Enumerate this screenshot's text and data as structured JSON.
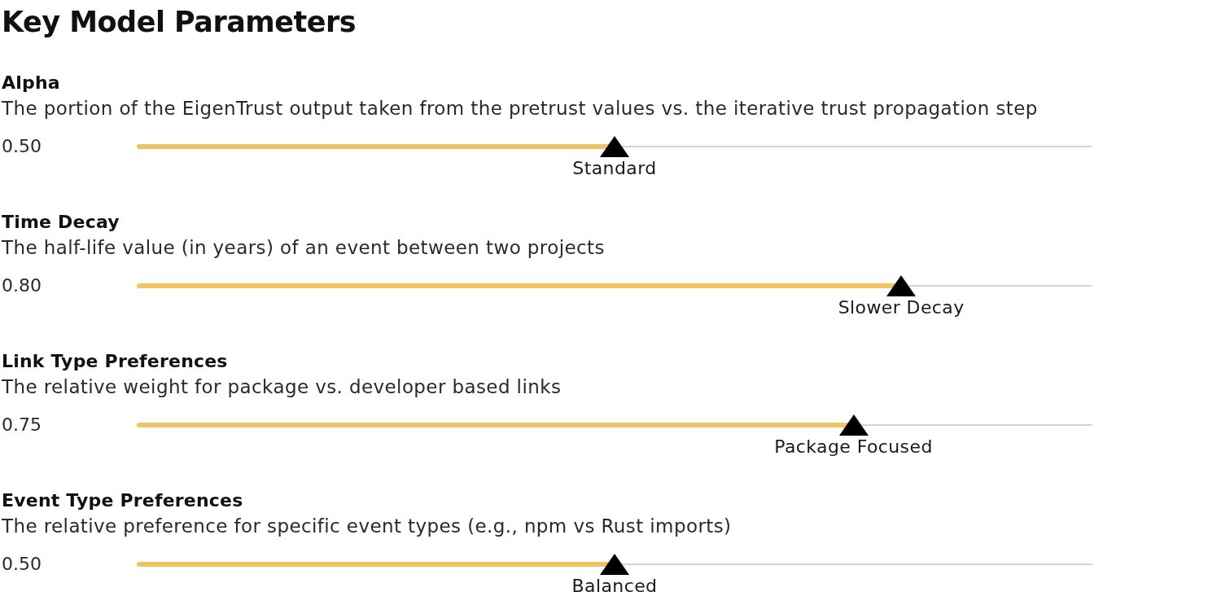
{
  "title": "Key Model Parameters",
  "parameters": [
    {
      "name": "Alpha",
      "description": "The portion of the EigenTrust output taken from the pretrust values vs. the iterative trust propagation step",
      "value": "0.50",
      "level": 0.5,
      "setting": "Standard"
    },
    {
      "name": "Time Decay",
      "description": "The half-life value (in years) of an event between two projects",
      "value": "0.80",
      "level": 0.8,
      "setting": "Slower Decay"
    },
    {
      "name": "Link Type Preferences",
      "description": "The relative weight for package vs. developer based links",
      "value": "0.75",
      "level": 0.75,
      "setting": "Package Focused"
    },
    {
      "name": "Event Type Preferences",
      "description": "The relative preference for specific event types (e.g., npm vs Rust imports)",
      "value": "0.50",
      "level": 0.5,
      "setting": "Balanced"
    }
  ]
}
